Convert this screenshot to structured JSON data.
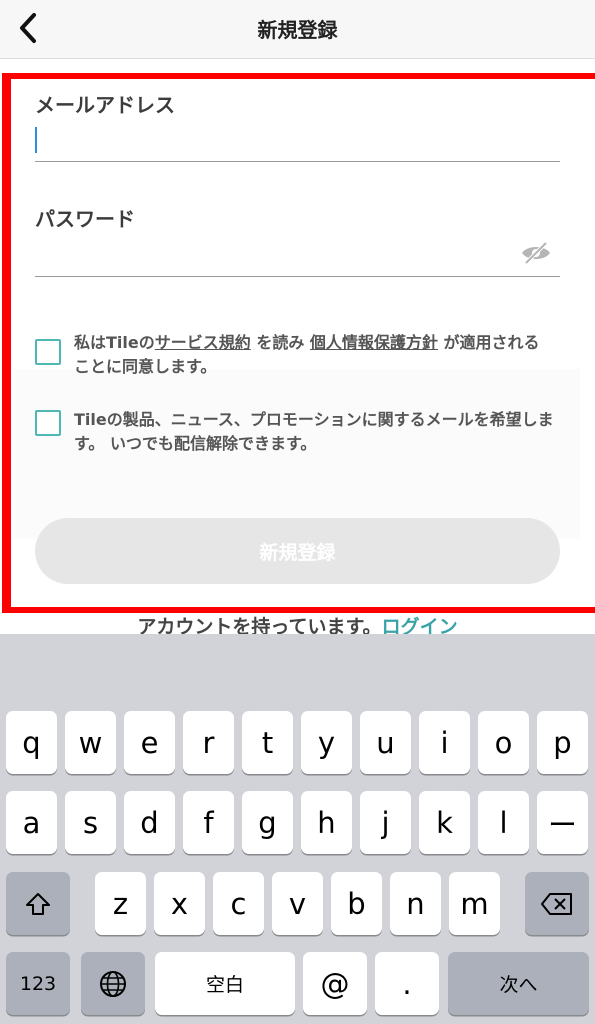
{
  "header": {
    "title": "新規登録"
  },
  "form": {
    "email": {
      "label": "メールアドレス",
      "value": ""
    },
    "password": {
      "label": "パスワード",
      "value": ""
    },
    "terms": {
      "prefix": "私はTileの",
      "terms_link": "サービス規約",
      "middle": " を読み ",
      "privacy_link": "個人情報保護方針",
      "suffix": " が適用されることに同意します。"
    },
    "newsletter": {
      "text": "Tileの製品、ニュース、プロモーションに関するメールを希望します。 いつでも配信解除できます。"
    },
    "submit_label": "新規登録",
    "account_text": "アカウントを持っています。",
    "login_label": "ログイン"
  },
  "keyboard": {
    "row1": [
      "q",
      "w",
      "e",
      "r",
      "t",
      "y",
      "u",
      "i",
      "o",
      "p"
    ],
    "row2": [
      "a",
      "s",
      "d",
      "f",
      "g",
      "h",
      "j",
      "k",
      "l",
      "ー"
    ],
    "row3": [
      "z",
      "x",
      "c",
      "v",
      "b",
      "n",
      "m"
    ],
    "bottom": {
      "numbers": "123",
      "space": "空白",
      "at": "@",
      "dot": ".",
      "next": "次へ"
    },
    "icons": {
      "shift": "shift-icon",
      "delete": "delete-icon",
      "globe": "globe-icon"
    }
  },
  "colors": {
    "accent": "#3aa3a7",
    "checkbox": "#4fb7b4",
    "highlight": "#ff0000",
    "disabled_button": "#e6e6e6"
  }
}
